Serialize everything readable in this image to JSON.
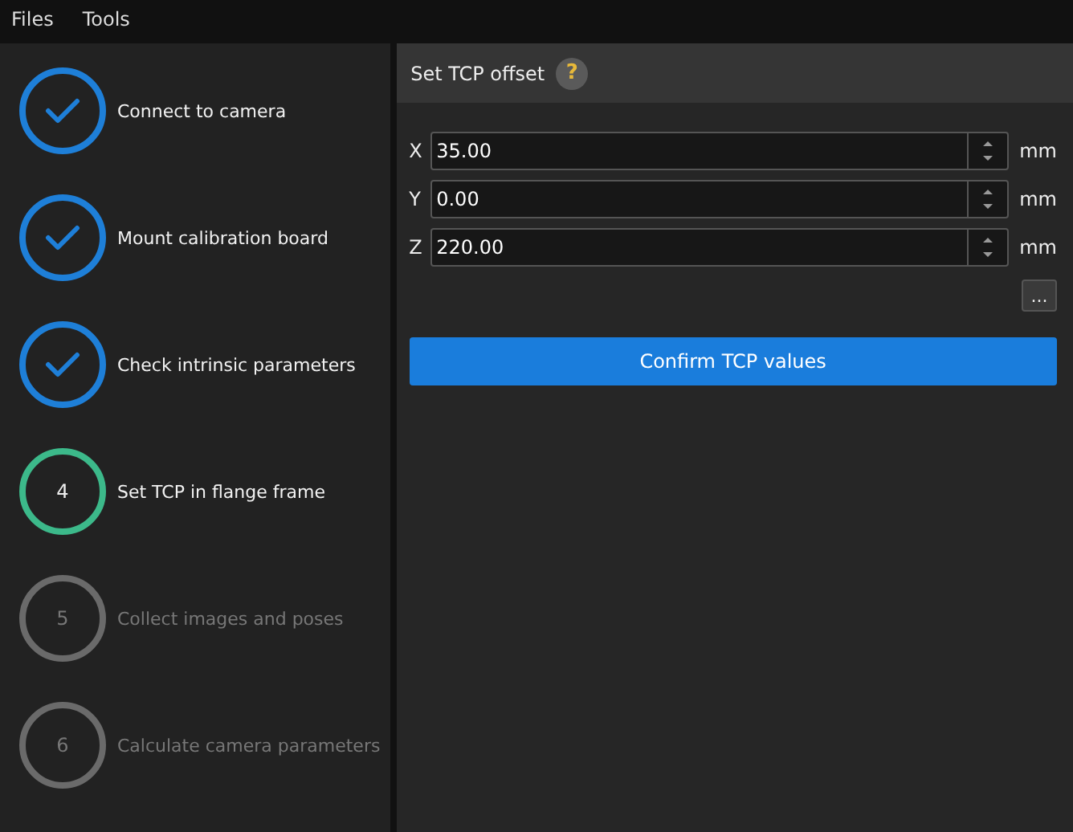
{
  "menu": [
    "Files",
    "Tools"
  ],
  "steps": [
    {
      "label": "Connect to camera",
      "kind": "done"
    },
    {
      "label": "Mount calibration board",
      "kind": "done"
    },
    {
      "label": "Check intrinsic parameters",
      "kind": "done"
    },
    {
      "label": "Set TCP in flange frame",
      "kind": "current",
      "number": "4"
    },
    {
      "label": "Collect images and poses",
      "kind": "pending",
      "number": "5"
    },
    {
      "label": "Calculate camera parameters",
      "kind": "pending",
      "number": "6"
    }
  ],
  "panel": {
    "title": "Set TCP offset",
    "help": "?",
    "fields": [
      {
        "label": "X",
        "value": "35.00",
        "unit": "mm"
      },
      {
        "label": "Y",
        "value": "0.00",
        "unit": "mm"
      },
      {
        "label": "Z",
        "value": "220.00",
        "unit": "mm"
      }
    ],
    "more_button": "...",
    "confirm_button": "Confirm TCP values"
  }
}
